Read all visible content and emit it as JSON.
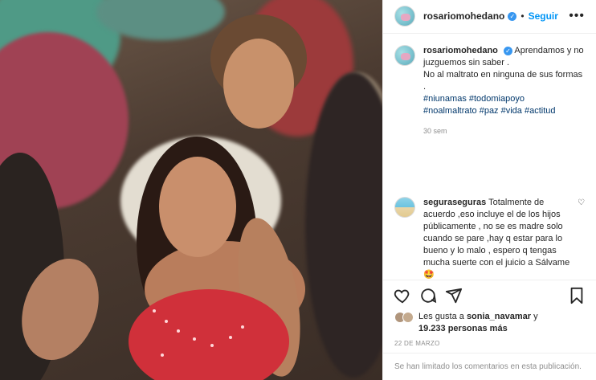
{
  "header": {
    "username": "rosariomohedano",
    "separator": "•",
    "follow_label": "Seguir",
    "more_label": "•••"
  },
  "caption": {
    "username": "rosariomohedano",
    "line1": "Aprendamos y no juzguemos sin saber .",
    "line2": "No al maltrato en ninguna de sus formas",
    "line3": ".",
    "hashtags_line1": "#niunamas #todomiapoyo",
    "hashtags_line2": "#noalmaltrato #paz #vida #actitud",
    "time": "30 sem"
  },
  "comment": {
    "username": "seguraseguras",
    "text": "Totalmente de acuerdo ,eso incluye el de los hijos públicamente , no se es madre solo cuando se pare ,hay q estar para lo bueno y lo malo , espero q tengas mucha suerte con el juicio a Sálvame 🤩"
  },
  "likes": {
    "prefix": "Les gusta a ",
    "user": "sonia_navamar",
    "middle": " y",
    "count": "19.233 personas más"
  },
  "date": "22 DE MARZO",
  "comments_disabled": "Se han limitado los comentarios en esta publicación.",
  "icons": {
    "verified": "verified-badge-icon",
    "heart": "heart-icon",
    "comment": "comment-icon",
    "share": "share-icon",
    "bookmark": "bookmark-icon"
  },
  "colors": {
    "link": "#0095f6",
    "hashtag": "#00376b",
    "muted": "#8e8e8e",
    "verified": "#3897f0"
  }
}
